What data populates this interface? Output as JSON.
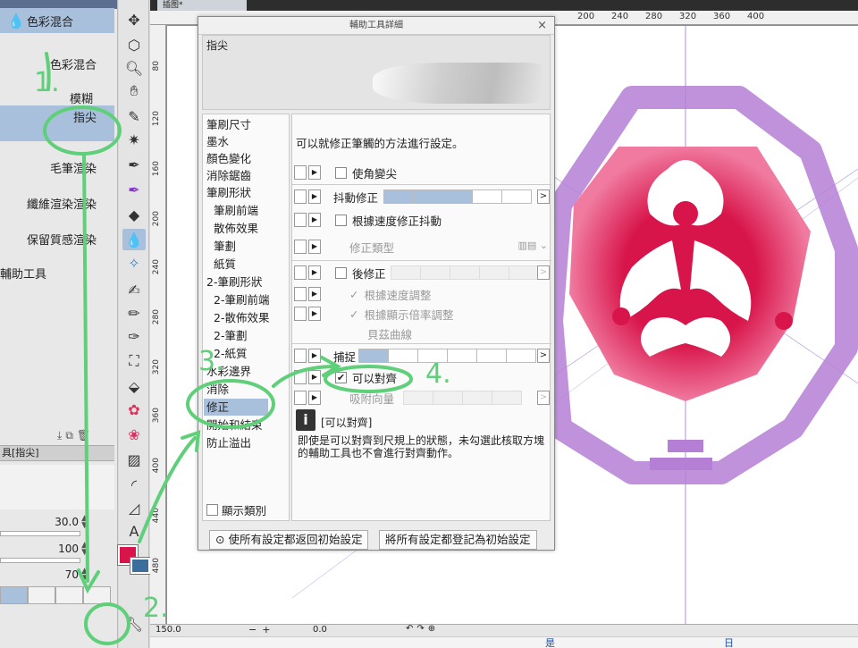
{
  "left_panel": {
    "header_partial": "輔助工具[色彩混合",
    "top_item": "色彩混合",
    "items": [
      "色彩混合",
      "模糊",
      "指尖",
      "毛筆渲染",
      "纖維渲染渲染",
      "保留質感渲染"
    ],
    "group_label": "輔助工具",
    "tab_label": "具[指尖]",
    "properties": [
      {
        "value": "30.0"
      },
      {
        "value": "100"
      },
      {
        "value": "70"
      }
    ]
  },
  "canvas": {
    "tab_label": "插图*",
    "ruler_top": [
      "200",
      "240",
      "280",
      "320",
      "360",
      "400"
    ],
    "ruler_left": [
      "80",
      "120",
      "160",
      "200",
      "240",
      "280",
      "320",
      "360",
      "400",
      "440",
      "480"
    ],
    "zoom": "150.0",
    "rotation": "0.0",
    "bottom_text": [
      "是",
      "日"
    ]
  },
  "dialog": {
    "title": "輔助工具詳細",
    "close": "×",
    "preview_name": "指尖",
    "categories": [
      {
        "label": "筆刷尺寸",
        "indent": false
      },
      {
        "label": "墨水",
        "indent": false
      },
      {
        "label": "顏色變化",
        "indent": false
      },
      {
        "label": "消除鋸齒",
        "indent": false
      },
      {
        "label": "筆刷形狀",
        "indent": false
      },
      {
        "label": "筆刷前端",
        "indent": true
      },
      {
        "label": "散佈效果",
        "indent": true
      },
      {
        "label": "筆劃",
        "indent": true
      },
      {
        "label": "紙質",
        "indent": true
      },
      {
        "label": "2-筆刷形狀",
        "indent": false
      },
      {
        "label": "2-筆刷前端",
        "indent": true
      },
      {
        "label": "2-散佈效果",
        "indent": true
      },
      {
        "label": "2-筆劃",
        "indent": true
      },
      {
        "label": "2-紙質",
        "indent": true
      },
      {
        "label": "水彩邊界",
        "indent": false
      },
      {
        "label": "消除",
        "indent": false
      },
      {
        "label": "修正",
        "indent": false,
        "selected": true
      },
      {
        "label": "開始和結束",
        "indent": false
      },
      {
        "label": "防止溢出",
        "indent": false
      }
    ],
    "show_categories": "顯示類別",
    "description": "可以就修正筆觸的方法進行設定。",
    "settings": {
      "corner": "使角變尖",
      "stabilization": "抖動修正",
      "speed_stabilize": "根據速度修正抖動",
      "correction_type": "修正類型",
      "post_correction": "後修正",
      "speed_adjust": "根據速度調整",
      "zoom_adjust": "根據顯示倍率調整",
      "bezier": "貝茲曲線",
      "vector_snap": "捕捉",
      "snap": "可以對齊",
      "attraction": "吸附向量",
      "arrow": ">",
      "play": "▶"
    },
    "info_title": "[可以對齊]",
    "info_body": "即使是可以對齊到尺規上的狀態，未勾選此核取方塊的輔助工具也不會進行對齊動作。",
    "reset_button": "使所有設定都返回初始設定",
    "register_button": "將所有設定都登記為初始設定"
  },
  "annotations": [
    "1.",
    "2.",
    "3.",
    "4."
  ],
  "colors": {
    "accent": "#a8c0dc",
    "main_color": "#d8154a",
    "sub_color": "#3c6e9c",
    "annotation_green": "#5fcf7a",
    "purple": "#b57fd6",
    "crimson": "#d8154a"
  }
}
